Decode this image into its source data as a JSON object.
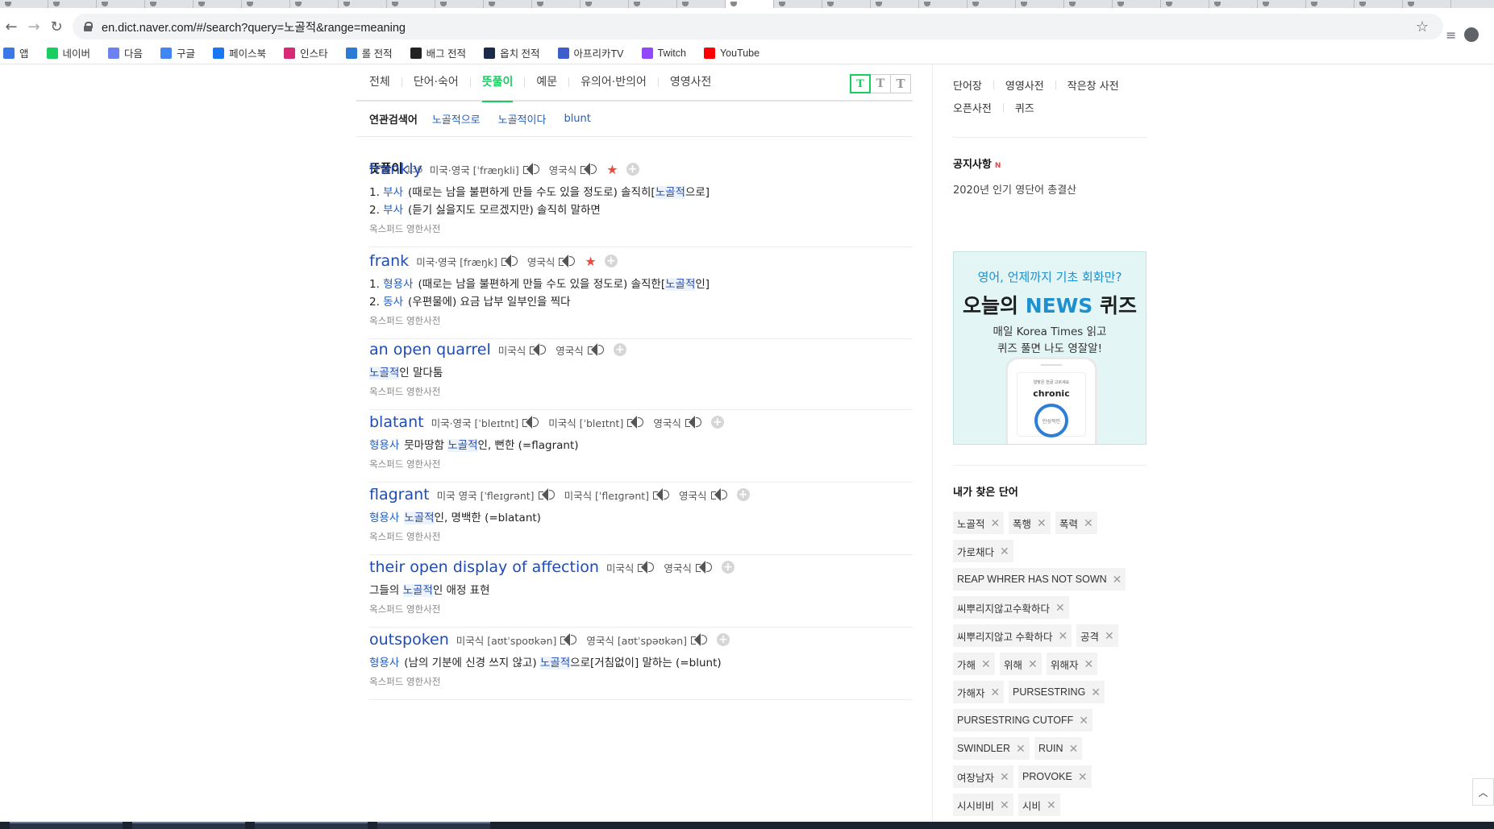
{
  "browser": {
    "url": "en.dict.naver.com/#/search?query=노골적&range=meaning",
    "bookmarks": [
      {
        "label": "앱",
        "color": "#3b78e7"
      },
      {
        "label": "네이버",
        "color": "#19ce60"
      },
      {
        "label": "다음",
        "color": "#6d82f2"
      },
      {
        "label": "구글",
        "color": "#4285f4"
      },
      {
        "label": "페이스북",
        "color": "#1877f2"
      },
      {
        "label": "인스타",
        "color": "#d62976"
      },
      {
        "label": "롤 전적",
        "color": "#2a7bd6"
      },
      {
        "label": "배그 전적",
        "color": "#222222"
      },
      {
        "label": "옵치 전적",
        "color": "#1b2a4a"
      },
      {
        "label": "아프리카TV",
        "color": "#3b5ecc"
      },
      {
        "label": "Twitch",
        "color": "#9146ff"
      },
      {
        "label": "YouTube",
        "color": "#ff0000"
      }
    ]
  },
  "nav": {
    "tabs": [
      "전체",
      "단어·숙어",
      "뜻풀이",
      "예문",
      "유의어·반의어",
      "영영사전"
    ],
    "active_tab": "뜻풀이",
    "fontsize": [
      "T",
      "T",
      "T"
    ]
  },
  "related": {
    "label": "연관검색어",
    "items": [
      "노골적으로",
      "노골적이다",
      "blunt"
    ]
  },
  "section": {
    "title": "뜻풀이",
    "count": "136"
  },
  "entries": [
    {
      "word": "frankly",
      "pron": [
        {
          "label": "미국·영국 [ˈfræŋkli]"
        },
        {
          "label": "영국식"
        }
      ],
      "starred": true,
      "defs": [
        {
          "num": "1.",
          "pos": "부사",
          "pre": "(때로는 남을 불편하게 만들 수도 있을 정도로) 솔직히[",
          "hl": "노골적",
          "post": "으로]"
        },
        {
          "num": "2.",
          "pos": "부사",
          "pre": "(듣기 싫을지도 모르겠지만) 솔직히 말하면",
          "hl": "",
          "post": ""
        }
      ],
      "source": "옥스퍼드 영한사전"
    },
    {
      "word": "frank",
      "pron": [
        {
          "label": "미국·영국 [fræŋk]"
        },
        {
          "label": "영국식"
        }
      ],
      "starred": true,
      "defs": [
        {
          "num": "1.",
          "pos": "형용사",
          "pre": "(때로는 남을 불편하게 만들 수도 있을 정도로) 솔직한[",
          "hl": "노골적",
          "post": "인]"
        },
        {
          "num": "2.",
          "pos": "동사",
          "pre": "(우편물에) 요금 납부 일부인을 찍다",
          "hl": "",
          "post": ""
        }
      ],
      "source": "옥스퍼드 영한사전"
    },
    {
      "word": "an open quarrel",
      "pron": [
        {
          "label": "미국식"
        },
        {
          "label": "영국식"
        }
      ],
      "starred": false,
      "defs": [
        {
          "num": "",
          "pos": "",
          "pre": "",
          "hl": "노골적",
          "post": "인 말다툼"
        }
      ],
      "source": "옥스퍼드 영한사전"
    },
    {
      "word": "blatant",
      "pron": [
        {
          "label": "미국·영국 [ˈbleɪtnt]"
        },
        {
          "label": "미국식 [ˈbleɪtnt]"
        },
        {
          "label": "영국식"
        }
      ],
      "starred": false,
      "defs": [
        {
          "num": "",
          "pos": "형용사",
          "pre": "뭇마땅함 ",
          "hl": "노골적",
          "post": "인, 뻔한 (=flagrant)"
        }
      ],
      "source": "옥스퍼드 영한사전"
    },
    {
      "word": "flagrant",
      "pron": [
        {
          "label": "미국 영국 [ˈfleɪɡrənt]"
        },
        {
          "label": "미국식 [ˈfleɪɡrənt]"
        },
        {
          "label": "영국식"
        }
      ],
      "starred": false,
      "defs": [
        {
          "num": "",
          "pos": "형용사",
          "pre": "",
          "hl": "노골적",
          "post": "인, 명백한 (=blatant)"
        }
      ],
      "source": "옥스퍼드 영한사전"
    },
    {
      "word": "their open display of affection",
      "pron": [
        {
          "label": "미국식"
        },
        {
          "label": "영국식"
        }
      ],
      "starred": false,
      "defs": [
        {
          "num": "",
          "pos": "",
          "pre": "그들의 ",
          "hl": "노골적",
          "post": "인 애정 표현"
        }
      ],
      "source": "옥스퍼드 영한사전"
    },
    {
      "word": "outspoken",
      "pron": [
        {
          "label": "미국식 [aʊtˈspoʊkən]"
        },
        {
          "label": "영국식 [aʊtˈspəʊkən]"
        }
      ],
      "starred": false,
      "defs": [
        {
          "num": "",
          "pos": "형용사",
          "pre": "(남의 기분에 신경 쓰지 않고) ",
          "hl": "노골적",
          "post": "으로[거침없이] 말하는 (=blunt)"
        }
      ],
      "source": "옥스퍼드 영한사전"
    }
  ],
  "right": {
    "quick_links": [
      "단어장",
      "영영사전",
      "작은창 사전",
      "오픈사전",
      "퀴즈"
    ],
    "notice": {
      "title": "공지사항",
      "badge": "N",
      "item": "2020년 인기 영단어 총결산"
    },
    "banner": {
      "line1": "영어, 언제까지 기초 회화만?",
      "line2_pre": "오늘의 ",
      "line2_news": "NEWS",
      "line2_post": " 퀴즈",
      "line3": "매일 Korea Times 읽고",
      "line4": "퀴즈 풀면 나도 영잘알!",
      "phone_tiny": "알맞은 한글 고르세요",
      "phone_word": "chronic",
      "phone_circle": "만성적인"
    },
    "mywords": {
      "title": "내가 찾은 단어",
      "chips": [
        [
          "노골적",
          "폭행",
          "폭력"
        ],
        [
          "가로채다"
        ],
        [
          "REAP WHRER HAS NOT SOWN"
        ],
        [
          "씨뿌리지않고수확하다"
        ],
        [
          "씨뿌리지않고 수확하다",
          "공격"
        ],
        [
          "가해",
          "위해",
          "위해자"
        ],
        [
          "가해자",
          "PURSESTRING"
        ],
        [
          "PURSESTRING CUTOFF"
        ],
        [
          "SWINDLER",
          "RUIN"
        ],
        [
          "여장남자",
          "PROVOKE"
        ],
        [
          "시시비비",
          "시비"
        ]
      ]
    }
  }
}
